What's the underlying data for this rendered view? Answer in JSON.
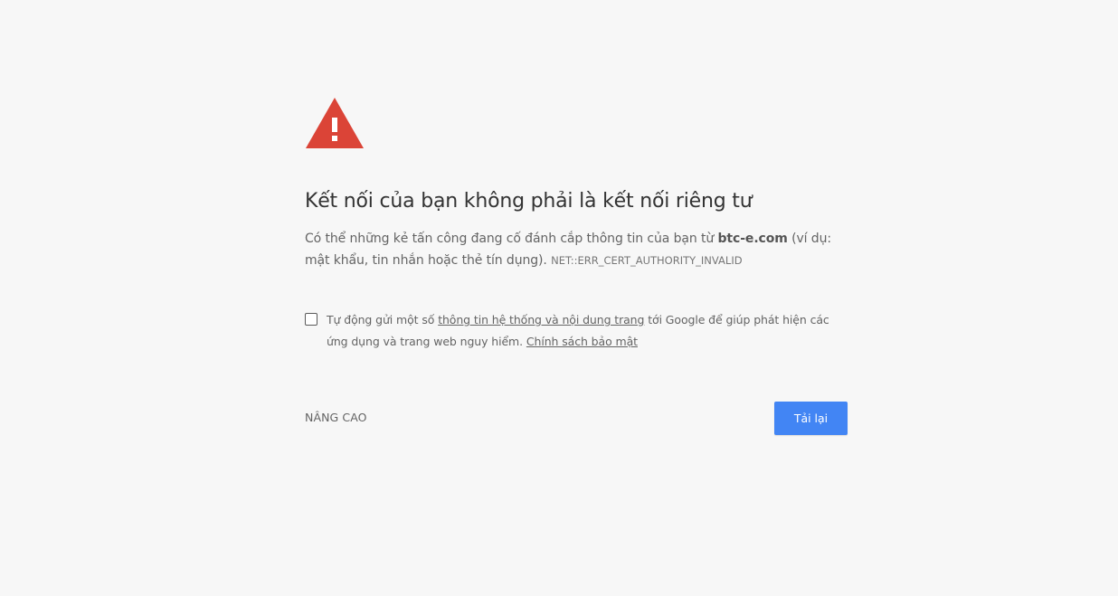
{
  "icon": {
    "name": "warning-triangle-icon",
    "color": "#db4437"
  },
  "heading": "Kết nối của bạn không phải là kết nối riêng tư",
  "explanation": {
    "prefix": "Có thể những kẻ tấn công đang cố đánh cắp thông tin của bạn từ ",
    "domain": "btc-e.com",
    "suffix": " (ví dụ: mật khẩu, tin nhắn hoặc thẻ tín dụng). ",
    "error_code": "NET::ERR_CERT_AUTHORITY_INVALID"
  },
  "report": {
    "checked": false,
    "text_before": "Tự động gửi một số ",
    "link_system_info": "thông tin hệ thống và nội dung trang",
    "text_after": " tới Google để giúp phát hiện các ứng dụng và trang web nguy hiểm. ",
    "link_privacy": "Chính sách bảo mật"
  },
  "buttons": {
    "advanced_label": "NÂNG CAO",
    "reload_label": "Tải lại",
    "reload_color": "#4285f4"
  }
}
